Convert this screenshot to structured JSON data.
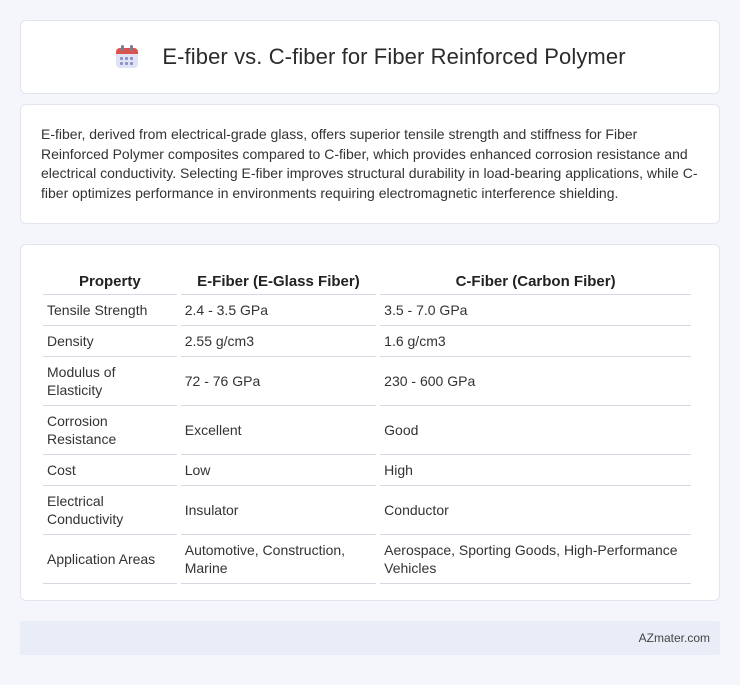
{
  "header": {
    "title": "E-fiber vs. C-fiber for Fiber Reinforced Polymer",
    "icon": "calendar-icon"
  },
  "intro": {
    "text": "E-fiber, derived from electrical-grade glass, offers superior tensile strength and stiffness for Fiber Reinforced Polymer composites compared to C-fiber, which provides enhanced corrosion resistance and electrical conductivity. Selecting E-fiber improves structural durability in load-bearing applications, while C-fiber optimizes performance in environments requiring electromagnetic interference shielding."
  },
  "table": {
    "headers": [
      "Property",
      "E-Fiber (E-Glass Fiber)",
      "C-Fiber (Carbon Fiber)"
    ],
    "rows": [
      [
        "Tensile Strength",
        "2.4 - 3.5 GPa",
        "3.5 - 7.0 GPa"
      ],
      [
        "Density",
        "2.55 g/cm3",
        "1.6 g/cm3"
      ],
      [
        "Modulus of Elasticity",
        "72 - 76 GPa",
        "230 - 600 GPa"
      ],
      [
        "Corrosion Resistance",
        "Excellent",
        "Good"
      ],
      [
        "Cost",
        "Low",
        "High"
      ],
      [
        "Electrical Conductivity",
        "Insulator",
        "Conductor"
      ],
      [
        "Application Areas",
        "Automotive, Construction, Marine",
        "Aerospace, Sporting Goods, High-Performance Vehicles"
      ]
    ]
  },
  "footer": {
    "brand": "AZmater.com"
  },
  "colors": {
    "background": "#f4f6fb",
    "card": "#ffffff",
    "footer": "#e9edf8",
    "icon_accent": "#d9534f"
  }
}
